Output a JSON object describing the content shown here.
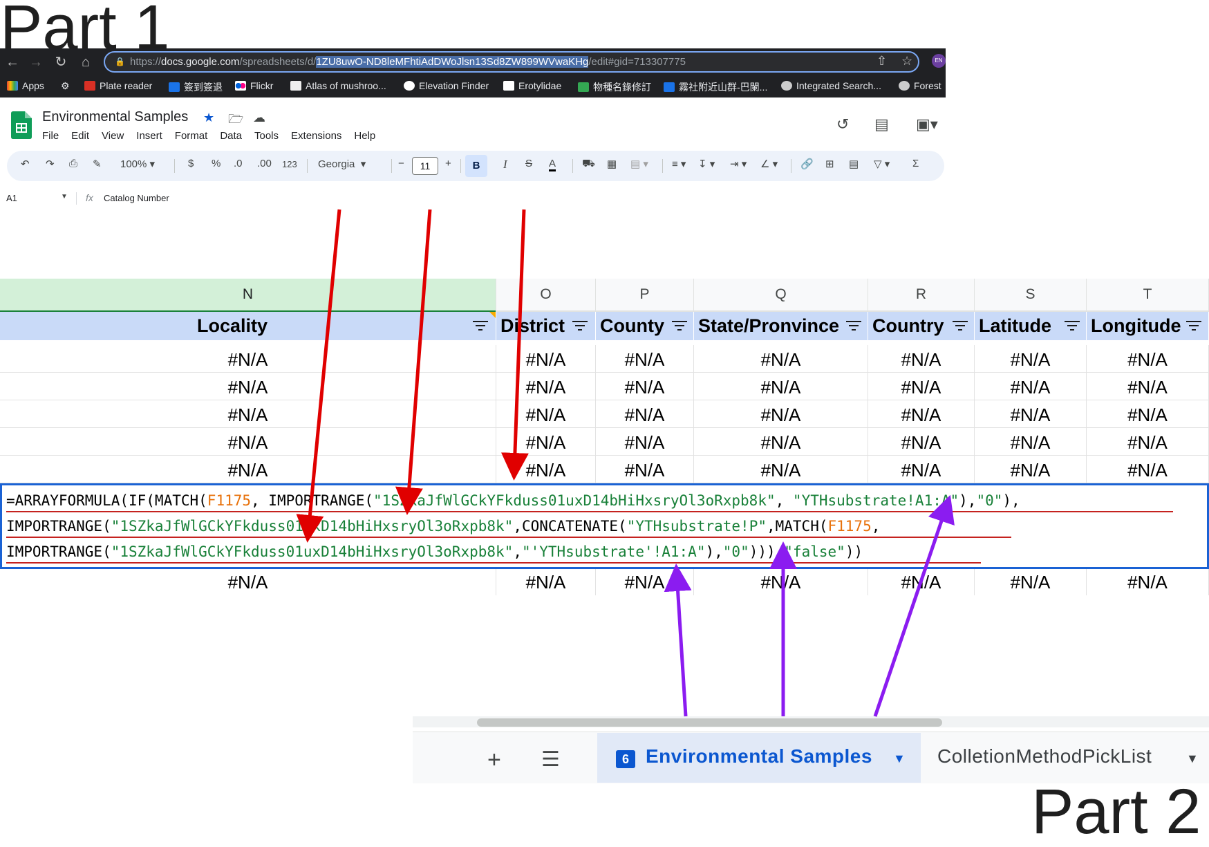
{
  "annotations": {
    "part1": "Part 1",
    "part2": "Part 2"
  },
  "browser": {
    "url_prefix": "https://",
    "url_host": "docs.google.com",
    "url_path1": "/spreadsheets/d/",
    "url_selected": "1ZU8uwO-ND8leMFhtiAdDWoJlsn13Sd8ZW899WVwaKHg",
    "url_suffix": "/edit#gid=713307775",
    "profile": "EN",
    "bookmarks": [
      "Apps",
      "Plate reader",
      "簽到簽退",
      "Flickr",
      "Atlas of mushroo...",
      "Elevation Finder",
      "Erotylidae",
      "物種名錄修訂",
      "霧社附近山群-巴闌...",
      "Integrated Search...",
      "Forest"
    ]
  },
  "sheets": {
    "title": "Environmental Samples",
    "menu": [
      "File",
      "Edit",
      "View",
      "Insert",
      "Format",
      "Data",
      "Tools",
      "Extensions",
      "Help"
    ],
    "toolbar": {
      "zoom": "100%",
      "currency": "$",
      "percent": "%",
      "dec_less": ".0",
      "dec_more": ".00",
      "format_123": "123",
      "font": "Georgia",
      "font_size": "11",
      "bold": "B",
      "italic": "I",
      "text_color": "A"
    },
    "name_box": "A1",
    "fx_label": "fx",
    "formula_preview": "Catalog Number"
  },
  "grid": {
    "columns": [
      {
        "letter": "N",
        "header": "Locality"
      },
      {
        "letter": "O",
        "header": "District"
      },
      {
        "letter": "P",
        "header": "County"
      },
      {
        "letter": "Q",
        "header": "State/Pronvince"
      },
      {
        "letter": "R",
        "header": "Country"
      },
      {
        "letter": "S",
        "header": "Latitude"
      },
      {
        "letter": "T",
        "header": "Longitude"
      }
    ],
    "cell_value": "#N/A"
  },
  "formula": {
    "line1": [
      {
        "t": "=ARRAYFORMULA(IF(MATCH(",
        "c": "plain"
      },
      {
        "t": "F1175",
        "c": "ref"
      },
      {
        "t": ", IMPORTRANGE(",
        "c": "plain"
      },
      {
        "t": "\"1SZkaJfWlGCkYFkduss01uxD14bHiHxsryOl3oRxpb8k\"",
        "c": "str"
      },
      {
        "t": ", ",
        "c": "plain"
      },
      {
        "t": "\"YTHsubstrate!A1:A\"",
        "c": "str"
      },
      {
        "t": "),",
        "c": "plain"
      },
      {
        "t": "\"0\"",
        "c": "str"
      },
      {
        "t": "),",
        "c": "plain"
      }
    ],
    "line2": [
      {
        "t": "IMPORTRANGE(",
        "c": "plain"
      },
      {
        "t": "\"1SZkaJfWlGCkYFkduss01uxD14bHiHxsryOl3oRxpb8k\"",
        "c": "str"
      },
      {
        "t": ",CONCATENATE(",
        "c": "plain"
      },
      {
        "t": "\"YTHsubstrate!P\"",
        "c": "str"
      },
      {
        "t": ",MATCH(",
        "c": "plain"
      },
      {
        "t": "F1175",
        "c": "ref"
      },
      {
        "t": ",",
        "c": "plain"
      }
    ],
    "line3": [
      {
        "t": "IMPORTRANGE(",
        "c": "plain"
      },
      {
        "t": "\"1SZkaJfWlGCkYFkduss01uxD14bHiHxsryOl3oRxpb8k\"",
        "c": "str"
      },
      {
        "t": ",",
        "c": "plain"
      },
      {
        "t": "\"'YTHsubstrate'!A1:A\"",
        "c": "str"
      },
      {
        "t": "),",
        "c": "plain"
      },
      {
        "t": "\"0\"",
        "c": "str"
      },
      {
        "t": "))),",
        "c": "plain"
      },
      {
        "t": "\"false\"",
        "c": "str"
      },
      {
        "t": "))",
        "c": "plain"
      }
    ]
  },
  "sheet_tabs": {
    "active": {
      "label": "Environmental Samples",
      "badge": "6"
    },
    "other": {
      "label": "ColletionMethodPickList"
    }
  },
  "colors": {
    "arrow_red": "#e00000",
    "arrow_purple": "#8b1cf0",
    "header_fill": "#c9daf8",
    "selected_col": "#d3f0d8"
  }
}
